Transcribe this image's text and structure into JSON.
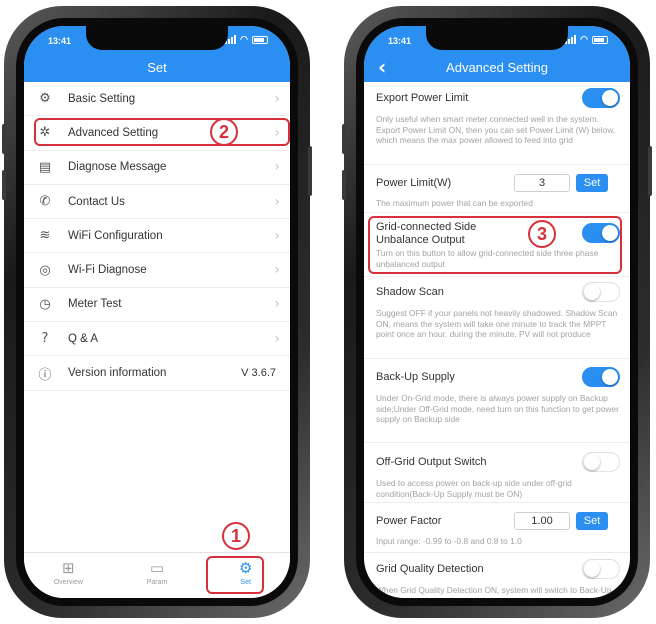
{
  "left_phone": {
    "status": {
      "time": "13:41"
    },
    "title": "Set",
    "menu": [
      {
        "label": "Basic Setting",
        "icon": "gear-icon"
      },
      {
        "label": "Advanced Setting",
        "icon": "advanced-gear-icon"
      },
      {
        "label": "Diagnose Message",
        "icon": "diagnose-icon"
      },
      {
        "label": "Contact Us",
        "icon": "phone-icon"
      },
      {
        "label": "WiFi Configuration",
        "icon": "wifi-icon"
      },
      {
        "label": "Wi-Fi Diagnose",
        "icon": "wifi-diagnose-icon"
      },
      {
        "label": "Meter Test",
        "icon": "meter-icon"
      },
      {
        "label": "Q & A",
        "icon": "qa-icon"
      },
      {
        "label": "Version information",
        "icon": "info-icon",
        "value": "V 3.6.7"
      }
    ],
    "bottom_nav": [
      {
        "label": "Overview",
        "icon": "grid-icon"
      },
      {
        "label": "Param",
        "icon": "document-icon"
      },
      {
        "label": "Set",
        "icon": "settings-icon",
        "active": true
      }
    ],
    "badges": {
      "step1": "1",
      "step2": "2"
    }
  },
  "right_phone": {
    "status": {
      "time": "13:41"
    },
    "title": "Advanced Setting",
    "badges": {
      "step3": "3"
    },
    "settings": {
      "export_power_limit": {
        "label": "Export Power Limit",
        "on": true,
        "desc": "Only useful when smart meter connected well in the system. Export Power Limit ON, then you can set Power Limit (W) below, which means the max power allowed to feed into grid"
      },
      "power_limit": {
        "label": "Power Limit(W)",
        "value": "3",
        "button": "Set",
        "desc": "The maximum power that can be exported"
      },
      "grid_unbalance": {
        "label_line1": "Grid-connected Side",
        "label_line2": "Unbalance Output",
        "on": true,
        "desc": "Turn on this button to allow grid-connected side three phase unbalanced output"
      },
      "shadow_scan": {
        "label": "Shadow Scan",
        "on": false,
        "desc": "Suggest OFF if your panels not heavily shadowed. Shadow Scan ON, means the system will take one minute to track the MPPT point once an hour, during the minute, PV will not produce"
      },
      "backup_supply": {
        "label": "Back-Up Supply",
        "on": true,
        "desc": "Under On-Grid mode, there is always power supply on Backup side;Under Off-Grid mode, need turn on this function to get power supply on Backup side"
      },
      "off_grid_switch": {
        "label": "Off-Grid Output Switch",
        "on": false,
        "desc": "Used to access power on back-up side under off-grid condition(Back-Up Supply must be ON)"
      },
      "power_factor": {
        "label": "Power Factor",
        "value": "1.00",
        "button": "Set",
        "desc": "Input range:  -0.99 to -0.8 and 0.8 to 1.0"
      },
      "grid_quality": {
        "label": "Grid Quality Detection",
        "on": false,
        "desc": "When Grid Quality Detection ON, system will switch to Back-Up mode when grid is abnormal"
      }
    }
  },
  "colors": {
    "accent": "#2a8ff0",
    "highlight": "#d6313a"
  }
}
